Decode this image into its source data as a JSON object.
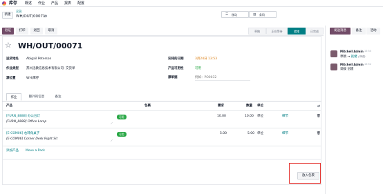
{
  "nav": {
    "app_name": "库存",
    "menu": [
      "概述",
      "作业",
      "产品",
      "报表",
      "配置"
    ]
  },
  "breadcrumb": {
    "parent": "交货",
    "current": "WH/OUT/00071",
    "gear_icon": "gear-icon"
  },
  "control_panel": {
    "new_label": "新建",
    "toggles": [
      {
        "icon": "list-icon",
        "label": "移动"
      },
      {
        "icon": "barcode-icon",
        "label": "条码"
      }
    ]
  },
  "actions": {
    "validate": "验证",
    "print": "打印",
    "return": "退回",
    "cancel": "取消"
  },
  "status_bar": {
    "steps": [
      "草稿",
      "正在等待",
      "就绪",
      "已完成"
    ],
    "active_index": 2
  },
  "chatter": {
    "send_message": "发送消息",
    "log_note": "备注",
    "activities": "活动",
    "messages": [
      {
        "author": "Mitchell Admin",
        "time": "13:54",
        "from": "草稿",
        "arrow": "→",
        "to": "就绪",
        "note": "(状态)"
      },
      {
        "author": "Mitchell Admin",
        "time": "13:52",
        "body": "调拨 创建"
      }
    ]
  },
  "record": {
    "name": "WH/OUT/00071",
    "fields_left": [
      {
        "label": "送货地址",
        "value": "Abigail Peterson"
      },
      {
        "label": "作业类型",
        "value": "苏州迅教信息技术有限公司: 交货单"
      },
      {
        "label": "源位置",
        "value": "WH/库存"
      }
    ],
    "fields_right": [
      {
        "label": "安排的日期",
        "value": "3月24日 13:53"
      },
      {
        "label": "产品可用性",
        "value": "可用"
      },
      {
        "label": "源单据",
        "value": "",
        "placeholder": "例如：PO0032"
      }
    ]
  },
  "tabs": [
    "作业",
    "额外的信息",
    "备注"
  ],
  "table": {
    "headers": {
      "product": "产品",
      "package": "包裹",
      "demand": "需求",
      "quantity": "数量",
      "unit": "单位"
    },
    "rows": [
      {
        "code": "[FURN_8888] 办公台灯",
        "desc": "[FURN_8888] Office Lamp",
        "badge": "可用",
        "demand": "10.00",
        "quantity": "10.00",
        "unit": "单位",
        "details": "细节"
      },
      {
        "code": "[E-COM06] 右转角桌子",
        "desc": "[E-COM06] Corner Desk Right Sit",
        "badge": "可用",
        "demand": "5.00",
        "quantity": "5.00",
        "unit": "单位",
        "details": "细节"
      }
    ],
    "add_product": "添加产品",
    "move_pack": "Move a Pack"
  },
  "put_in_pack": "放入包裹",
  "colors": {
    "primary": "#714b67",
    "teal": "#017e84",
    "success": "#28a745",
    "highlight": "#e53935"
  }
}
